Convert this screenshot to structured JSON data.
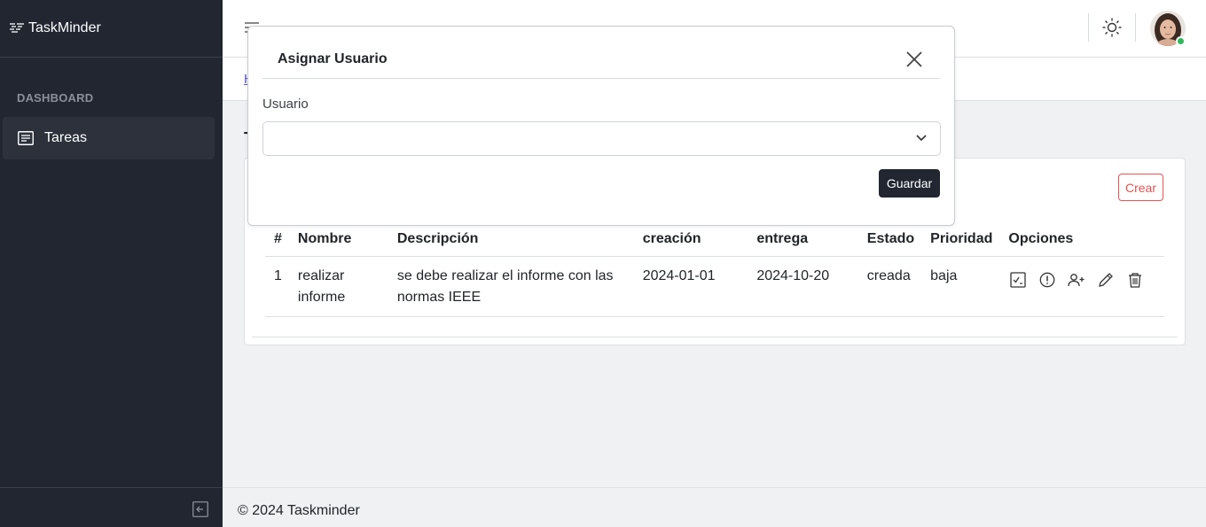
{
  "app": {
    "brand": "TaskMinder"
  },
  "sidebar": {
    "section_title": "DASHBOARD",
    "items": [
      {
        "label": "Tareas",
        "icon": "list-icon"
      }
    ]
  },
  "header": {
    "breadcrumb_link": "H",
    "status_color": "#2eb85c"
  },
  "main": {
    "title": "T",
    "create_button": "Crear",
    "table": {
      "headers": [
        "#",
        "Nombre",
        "Descripción",
        "creación",
        "entrega",
        "Estado",
        "Prioridad",
        "Opciones"
      ],
      "rows": [
        {
          "id": "1",
          "nombre": "realizar informe",
          "descripcion": "se debe realizar el informe con las normas IEEE",
          "creacion": "2024-01-01",
          "entrega": "2024-10-20",
          "estado": "creada",
          "prioridad": "baja",
          "options": [
            "checklist-icon",
            "alert-icon",
            "add-user-icon",
            "edit-icon",
            "trash-icon"
          ]
        }
      ]
    }
  },
  "modal": {
    "title": "Asignar Usuario",
    "field_label": "Usuario",
    "selected_value": "",
    "save_button": "Guardar"
  },
  "footer": {
    "text": "© 2024 Taskminder"
  }
}
